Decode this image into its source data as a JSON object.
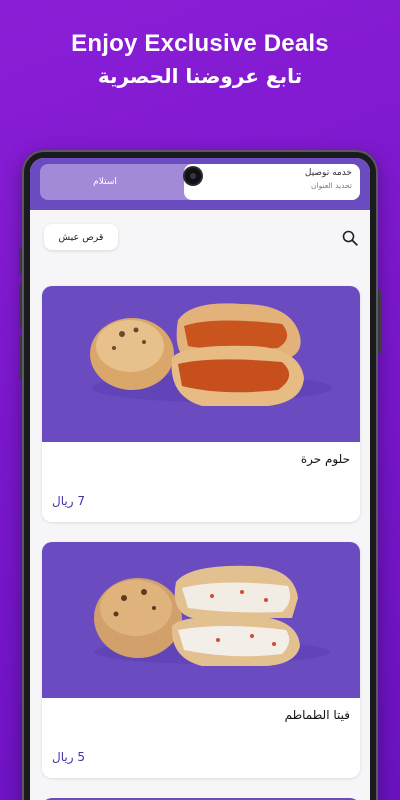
{
  "hero": {
    "title": "Enjoy Exclusive Deals",
    "subtitle": "تابع عروضنا الحصرية"
  },
  "delivery_toggle": {
    "pickup_label": "استلام",
    "delivery_title": "خدمه توصيل",
    "delivery_subtitle": "تحديد العنوان",
    "chevron": "‹"
  },
  "filter": {
    "chip_label": "قرص عيش",
    "search_icon": "search-icon"
  },
  "products": [
    {
      "name": "حلوم حرة",
      "price": "7 ريال"
    },
    {
      "name": "فيتا الطماطم",
      "price": "5 ريال"
    }
  ],
  "colors": {
    "background": "#7a17cc",
    "brand_purple": "#6a4cc0",
    "price_color": "#4a2fa8"
  }
}
